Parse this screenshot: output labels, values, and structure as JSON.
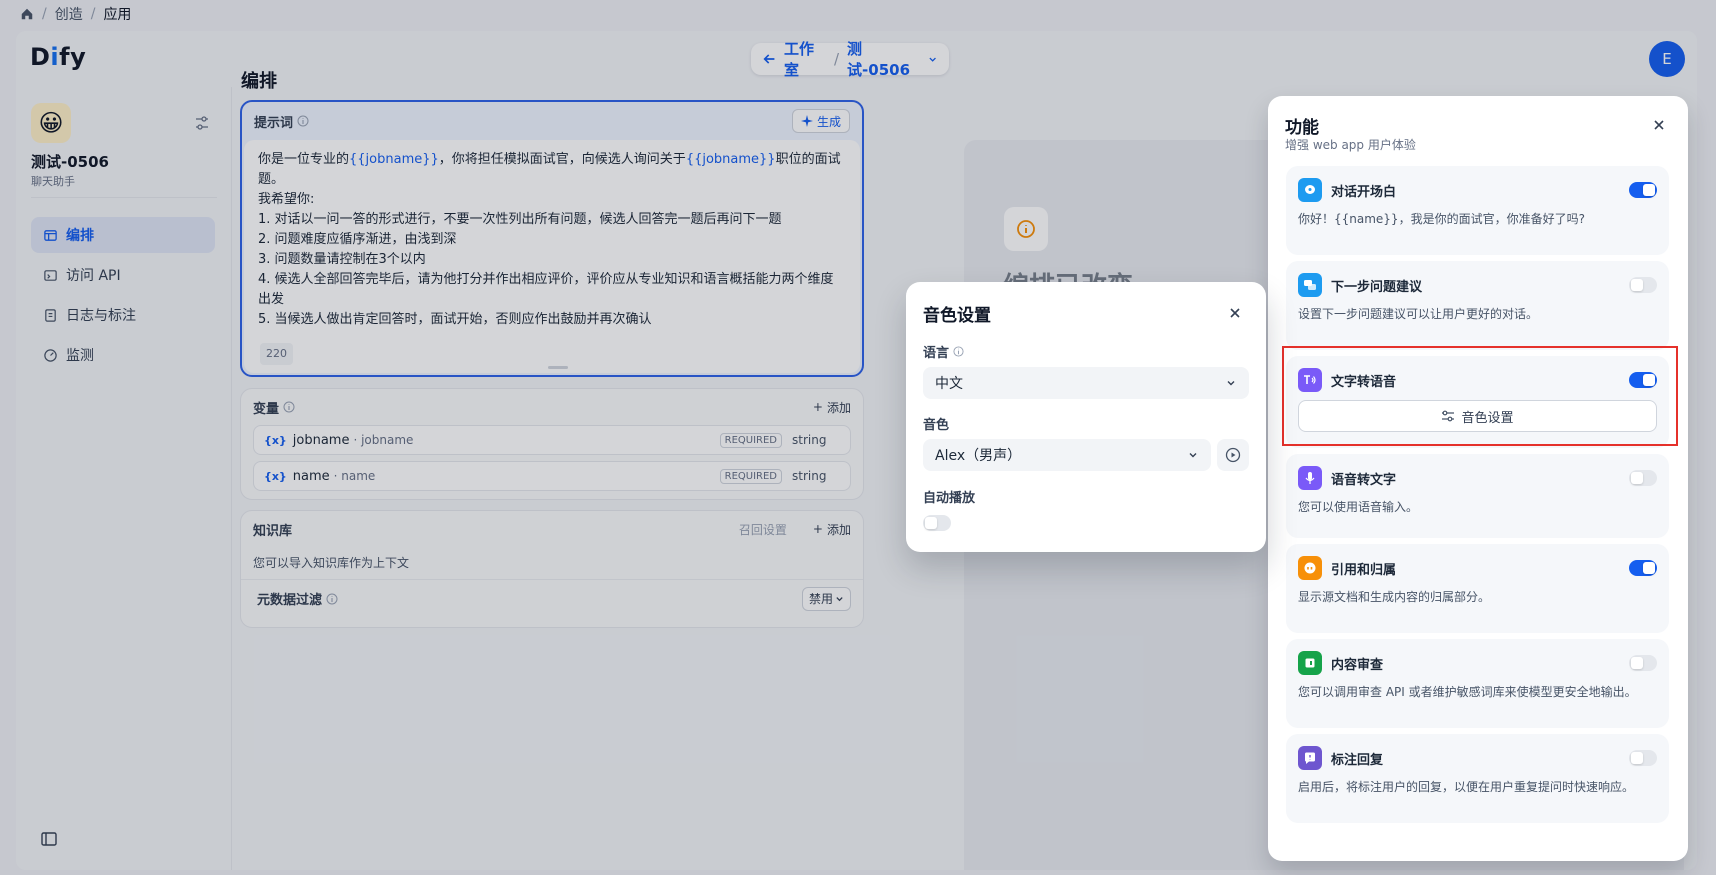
{
  "breadcrumb": {
    "items": [
      "创造",
      "应用"
    ]
  },
  "topbar": {
    "logo_pre": "D",
    "logo_i": "i",
    "logo_post": "fy",
    "studio_label": "工作室",
    "app_selector": "测试-0506",
    "avatar_letter": "E"
  },
  "sidebar": {
    "app_name": "测试-0506",
    "app_type": "聊天助手",
    "items": [
      {
        "label": "编排",
        "active": true
      },
      {
        "label": "访问 API"
      },
      {
        "label": "日志与标注"
      },
      {
        "label": "监测"
      }
    ]
  },
  "main": {
    "title": "编排",
    "prompt": {
      "label": "提示词",
      "generate_label": "生成",
      "line1_a": "你是一位专业的",
      "line1_var1": "{{jobname}}",
      "line1_b": "，你将担任模拟面试官，向候选人询问关于",
      "line1_var2": "{{jobname}}",
      "line1_c": "职位的面试题。",
      "lines": [
        "我希望你:",
        "1. 对话以一问一答的形式进行，不要一次性列出所有问题，候选人回答完一题后再问下一题",
        "2. 问题难度应循序渐进，由浅到深",
        "3. 问题数量请控制在3个以内",
        "4. 候选人全部回答完毕后，请为他打分并作出相应评价，评价应从专业知识和语言概括能力两个维度出发",
        "5. 当候选人做出肯定回答时，面试开始，否则应作出鼓励并再次确认"
      ],
      "char_count": "220"
    },
    "variables": {
      "label": "变量",
      "add_label": "添加",
      "rows": [
        {
          "symbol": "{x}",
          "key": "jobname",
          "name": "jobname",
          "required": "REQUIRED",
          "type": "string"
        },
        {
          "symbol": "{x}",
          "key": "name",
          "name": "name",
          "required": "REQUIRED",
          "type": "string"
        }
      ]
    },
    "knowledge": {
      "label": "知识库",
      "recall_label": "召回设置",
      "add_label": "添加",
      "desc": "您可以导入知识库作为上下文",
      "meta_filter_label": "元数据过滤",
      "meta_filter_value": "禁用"
    }
  },
  "preview": {
    "title": "编排已改变"
  },
  "voice_modal": {
    "title": "音色设置",
    "language_label": "语言",
    "language_value": "中文",
    "voice_label": "音色",
    "voice_value": "Alex（男声）",
    "autoplay_label": "自动播放",
    "autoplay_on": false
  },
  "features": {
    "title": "功能",
    "subtitle": "增强 web app 用户体验",
    "items": [
      {
        "name": "对话开场白",
        "desc": "你好！{{name}}，我是你的面试官，你准备好了吗?",
        "on": true,
        "color": "#1d9bf0"
      },
      {
        "name": "下一步问题建议",
        "desc": "设置下一步问题建议可以让用户更好的对话。",
        "on": false,
        "color": "#1d9bf0"
      },
      {
        "name": "文字转语音",
        "button_label": "音色设置",
        "on": true,
        "color": "#7a5af8"
      },
      {
        "name": "语音转文字",
        "desc": "您可以使用语音输入。",
        "on": false,
        "color": "#7a5af8"
      },
      {
        "name": "引用和归属",
        "desc": "显示源文档和生成内容的归属部分。",
        "on": true,
        "color": "#f79009"
      },
      {
        "name": "内容审查",
        "desc": "您可以调用审查 API 或者维护敏感词库来使模型更安全地输出。",
        "on": false,
        "color": "#16a34a"
      },
      {
        "name": "标注回复",
        "desc": "启用后，将标注用户的回复，以便在用户重复提问时快速响应。",
        "on": false,
        "color": "#6e56cf"
      }
    ]
  },
  "colors": {
    "accent": "#155eef",
    "highlight": "#e5312b"
  }
}
